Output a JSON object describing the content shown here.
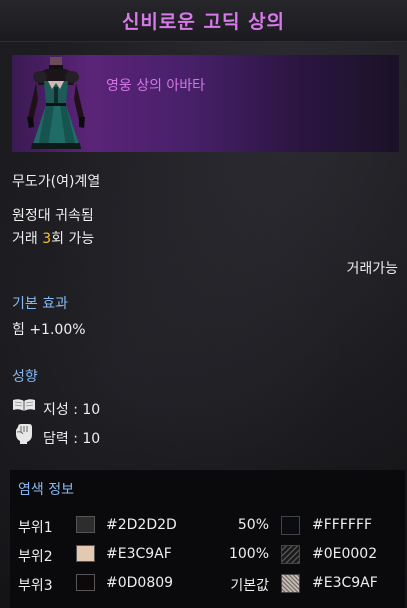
{
  "title": "신비로운 고딕 상의",
  "item": {
    "category_label": "영웅 상의 아바타",
    "class_restriction": "무도가(여)계열",
    "bound": "원정대 귀속됨",
    "trade_prefix": "거래 ",
    "trade_count": "3",
    "trade_suffix": "회 가능",
    "tradable": "거래가능"
  },
  "base_effect": {
    "heading": "기본 효과",
    "stat": "힘 +1.00%"
  },
  "tendency": {
    "heading": "성향",
    "items": [
      {
        "icon": "book-icon",
        "label": "지성 : 10"
      },
      {
        "icon": "fist-icon",
        "label": "담력 : 10"
      }
    ]
  },
  "dye": {
    "heading": "염색 정보",
    "rows": [
      {
        "part": "부위1",
        "color": "#2D2D2D",
        "swatch": "#2d2d2d",
        "amount": "50%",
        "pattern_color": "#FFFFFF",
        "pattern": "dark"
      },
      {
        "part": "부위2",
        "color": "#E3C9AF",
        "swatch": "#e3c9af",
        "amount": "100%",
        "pattern_color": "#0E0002",
        "pattern": "stripes"
      },
      {
        "part": "부위3",
        "color": "#0D0809",
        "swatch": "#0d0809",
        "amount": "기본값",
        "pattern_color": "#E3C9AF",
        "pattern": "lace"
      }
    ]
  }
}
